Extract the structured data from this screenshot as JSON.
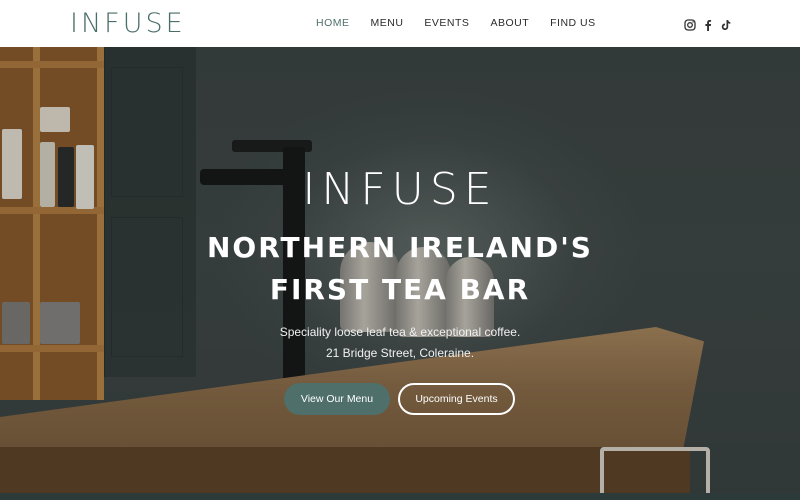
{
  "header": {
    "logo_text": "INFUSE",
    "nav": [
      {
        "label": "HOME"
      },
      {
        "label": "MENU"
      },
      {
        "label": "EVENTS"
      },
      {
        "label": "ABOUT"
      },
      {
        "label": "FIND US"
      }
    ],
    "social_icons": [
      "instagram-icon",
      "facebook-icon",
      "tiktok-icon"
    ],
    "accent_color": "#4f6f6b"
  },
  "hero": {
    "logo_text": "INFUSE",
    "title_line1": "NORTHERN IRELAND'S",
    "title_line2": "FIRST TEA BAR",
    "subtitle_line1": "Speciality loose leaf tea & exceptional coffee.",
    "subtitle_line2": "21 Bridge Street, Coleraine.",
    "primary_button": "View Our Menu",
    "secondary_button": "Upcoming Events"
  }
}
